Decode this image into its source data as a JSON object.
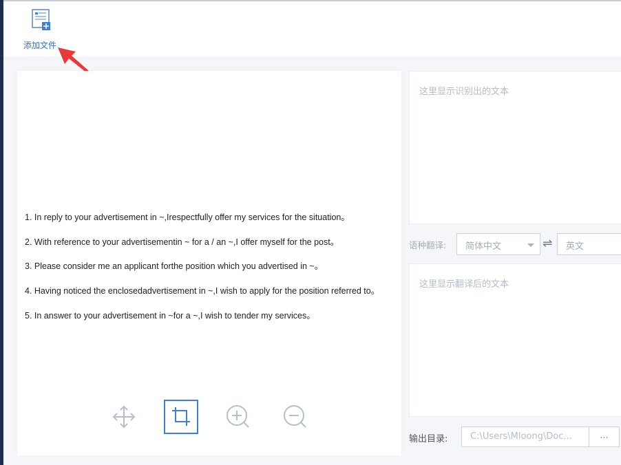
{
  "toolbar": {
    "add_file_label": "添加文件"
  },
  "document": {
    "lines": [
      "1. In reply to your advertisement in ~,Irespectfully offer my services for the situation。",
      "2. With reference to your advertisementin ~ for a / an ~,I offer myself for the post。",
      "3. Please consider me an applicant forthe position which you advertised in ~。",
      "4. Having noticed the enclosedadvertisement in ~,I wish to apply for the position referred to。",
      "5. In answer to your advertisement in ~for a ~,I wish to tender my services。"
    ]
  },
  "image_tools": [
    "move-icon",
    "crop-icon",
    "zoom-in-icon",
    "zoom-out-icon"
  ],
  "recognized": {
    "placeholder": "这里显示识别出的文本"
  },
  "translation": {
    "label": "语种翻译:",
    "source_lang": "简体中文",
    "target_lang": "英文",
    "placeholder": "这里显示翻译后的文本"
  },
  "output": {
    "label": "输出目录:",
    "path": "C:\\Users\\Mloong\\Doc...",
    "browse_label": "..."
  },
  "colors": {
    "accent": "#3d7fd0",
    "annotation_arrow": "#e83a3a",
    "sidebar": "#1d2d4a"
  }
}
